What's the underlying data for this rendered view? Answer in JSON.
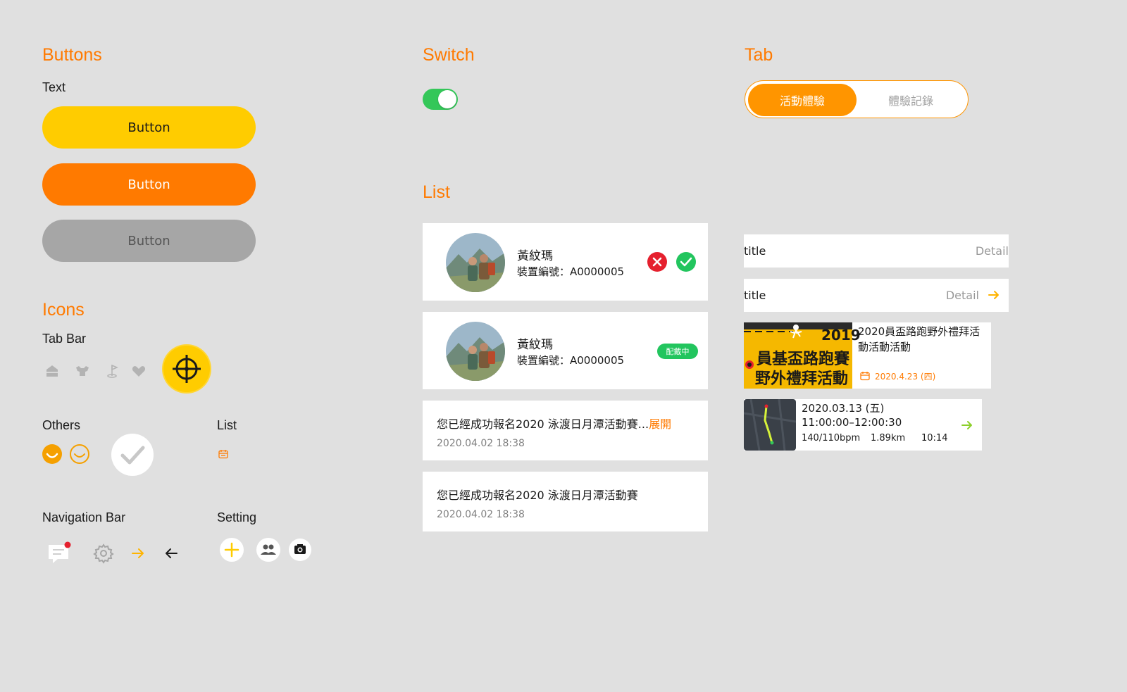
{
  "sections": {
    "buttons": "Buttons",
    "switch": "Switch",
    "tab": "Tab",
    "list": "List",
    "icons": "Icons"
  },
  "buttons": {
    "subtitle": "Text",
    "primary_label": "Button",
    "secondary_label": "Button",
    "disabled_label": "Button"
  },
  "icons": {
    "tab_bar_label": "Tab Bar",
    "tab_bar_icons": [
      "home-icon",
      "muscle-icon",
      "golf-flag-icon",
      "heart-icon"
    ],
    "others_label": "Others",
    "list_label": "List",
    "navigation_bar_label": "Navigation Bar",
    "setting_label": "Setting"
  },
  "switch": {
    "on": true
  },
  "tab": {
    "active_label": "活動體驗",
    "inactive_label": "體驗記錄"
  },
  "list": {
    "persons": [
      {
        "name": "黃紋瑪",
        "device": "裝置編號：A0000005"
      },
      {
        "name": "黃紋瑪",
        "device": "裝置編號：A0000005",
        "badge": "配戴中"
      }
    ],
    "notices": [
      {
        "text": "您已經成功報名2020 泳渡日月潭活動賽...",
        "expand": "展開",
        "time": "2020.04.02 18:38"
      },
      {
        "text": "您已經成功報名2020 泳渡日月潭活動賽",
        "time": "2020.04.02 18:38"
      }
    ]
  },
  "detail_rows": [
    {
      "title": "title",
      "detail": "Detail"
    },
    {
      "title": "title",
      "detail": "Detail"
    }
  ],
  "event_card": {
    "banner_line1": "2019",
    "banner_line2": "員基盃路跑賽",
    "banner_line3": "野外禮拜活動",
    "title": "2020員盃路跑野外禮拜活動活動活動",
    "date": "2020.4.23 (四)"
  },
  "run_card": {
    "date": "2020.03.13 (五)",
    "time": "11:00:00–12:00:30",
    "bpm": "140/110bpm",
    "distance": "1.89km",
    "duration": "10:14"
  },
  "colors": {
    "accent": "#ff7a00",
    "yellow": "#ffcc00",
    "green": "#22c55e",
    "red": "#e5202e",
    "background": "#e0e0e0"
  }
}
